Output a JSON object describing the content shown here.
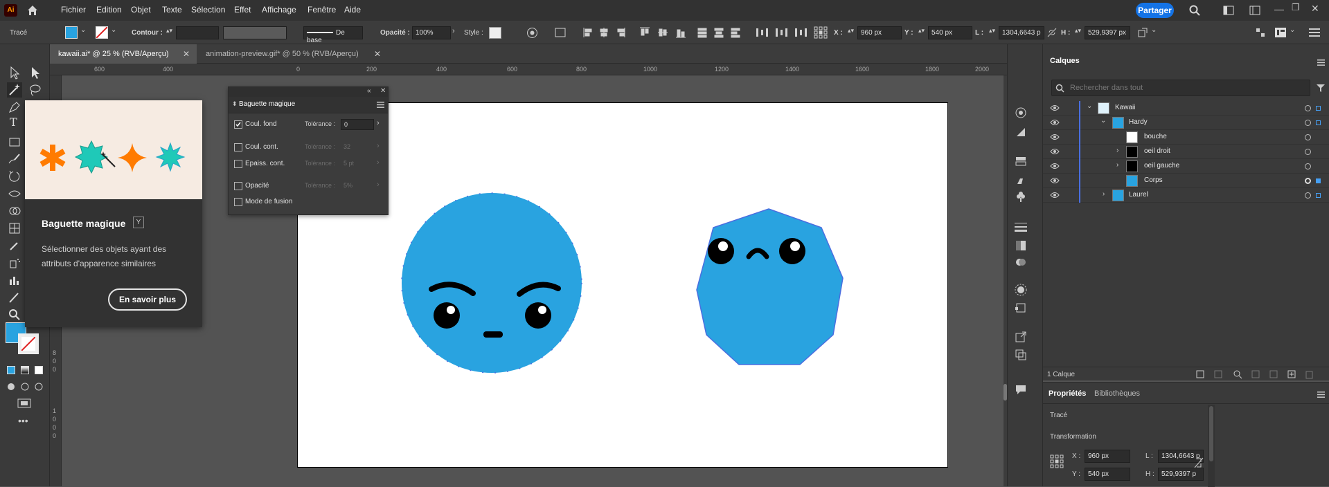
{
  "menubar": {
    "logo": "Ai",
    "items": [
      "Fichier",
      "Edition",
      "Objet",
      "Texte",
      "Sélection",
      "Effet",
      "Affichage",
      "Fenêtre",
      "Aide"
    ],
    "share": "Partager"
  },
  "controlbar": {
    "object_type": "Tracé",
    "fill_color": "#29a3e0",
    "stroke_label": "Contour :",
    "stroke_style": "De base",
    "opacity_label": "Opacité :",
    "opacity_value": "100%",
    "style_label": "Style :",
    "x_label": "X :",
    "x_value": "960 px",
    "y_label": "Y :",
    "y_value": "540 px",
    "w_label": "L :",
    "w_value": "1304,6643 p",
    "h_label": "H :",
    "h_value": "529,9397 px"
  },
  "tabs": [
    {
      "label": "kawaii.ai* @ 25 % (RVB/Aperçu)",
      "active": true
    },
    {
      "label": "animation-preview.gif* @ 50 % (RVB/Aperçu)",
      "active": false
    }
  ],
  "ruler": {
    "h_ticks": [
      "600",
      "400",
      "0",
      "200",
      "400",
      "600",
      "800",
      "1000",
      "1200",
      "1400",
      "1600",
      "1800",
      "2000"
    ],
    "v_ticks": [
      "8",
      "0",
      "0",
      "1",
      "0",
      "0",
      "0"
    ]
  },
  "tooltip": {
    "title": "Baguette magique",
    "shortcut": "Y",
    "description": "Sélectionner des objets ayant des attributs d'apparence similaires",
    "learn_more": "En savoir plus"
  },
  "magic_wand_panel": {
    "title": "Baguette magique",
    "rows": [
      {
        "label": "Coul. fond",
        "checked": true,
        "tolerance_label": "Tolérance :",
        "tolerance": "0",
        "enabled": true
      },
      {
        "label": "Coul. cont.",
        "checked": false,
        "tolerance_label": "Tolérance :",
        "tolerance": "32",
        "enabled": false
      },
      {
        "label": "Epaiss. cont.",
        "checked": false,
        "tolerance_label": "Tolérance :",
        "tolerance": "5 pt",
        "enabled": false
      },
      {
        "label": "Opacité",
        "checked": false,
        "tolerance_label": "Tolérance :",
        "tolerance": "5%",
        "enabled": false
      },
      {
        "label": "Mode de fusion",
        "checked": false
      }
    ]
  },
  "layers_panel": {
    "title": "Calques",
    "search_placeholder": "Rechercher dans tout",
    "layers": [
      {
        "name": "Kawaii",
        "depth": 0,
        "expanded": true
      },
      {
        "name": "Hardy",
        "depth": 1,
        "expanded": true
      },
      {
        "name": "bouche",
        "depth": 2
      },
      {
        "name": "oeil droit",
        "depth": 2,
        "expandable": true
      },
      {
        "name": "oeil gauche",
        "depth": 2,
        "expandable": true
      },
      {
        "name": "Corps",
        "depth": 2
      },
      {
        "name": "Laurel",
        "depth": 1,
        "expandable": true
      }
    ],
    "footer_count": "1 Calque"
  },
  "properties_panel": {
    "tabs": [
      "Propriétés",
      "Bibliothèques"
    ],
    "object_type": "Tracé",
    "section": "Transformation",
    "x_label": "X :",
    "x_value": "960 px",
    "y_label": "Y :",
    "y_value": "540 px",
    "w_label": "L :",
    "w_value": "1304,6643 p",
    "h_label": "H :",
    "h_value": "529,9397 p"
  },
  "colors": {
    "accent": "#1473e6",
    "character_blue": "#29a3e0",
    "selection": "#4a6ee0",
    "orange": "#ff7b00",
    "teal": "#1fc9b8"
  }
}
